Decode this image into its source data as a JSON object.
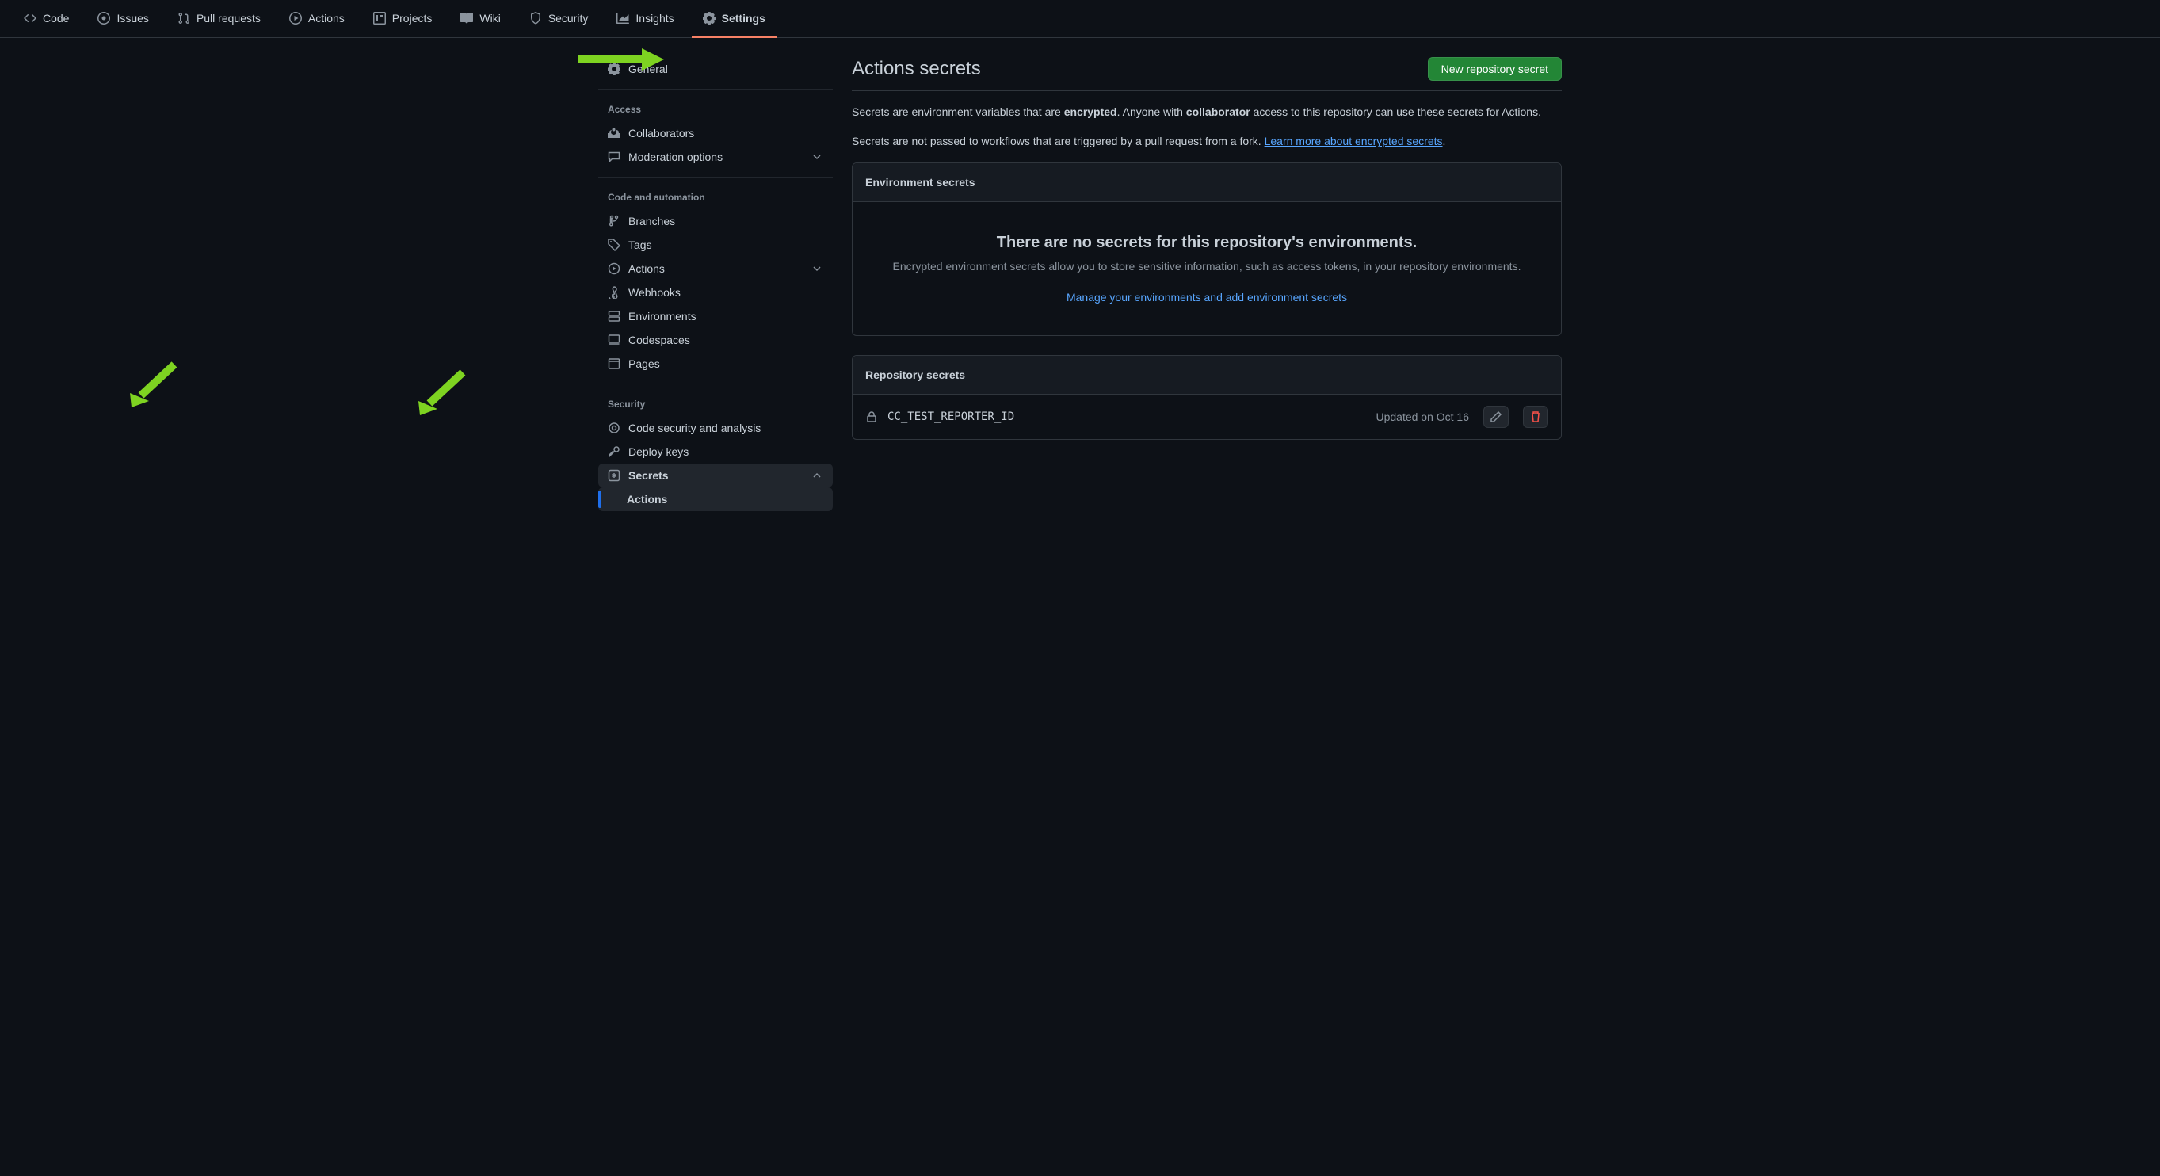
{
  "nav": {
    "code": "Code",
    "issues": "Issues",
    "pull": "Pull requests",
    "actions": "Actions",
    "projects": "Projects",
    "wiki": "Wiki",
    "security": "Security",
    "insights": "Insights",
    "settings": "Settings"
  },
  "sidebar": {
    "general": "General",
    "access_heading": "Access",
    "collaborators": "Collaborators",
    "moderation": "Moderation options",
    "code_auto_heading": "Code and automation",
    "branches": "Branches",
    "tags": "Tags",
    "actions": "Actions",
    "webhooks": "Webhooks",
    "environments": "Environments",
    "codespaces": "Codespaces",
    "pages": "Pages",
    "security_heading": "Security",
    "code_security": "Code security and analysis",
    "deploy_keys": "Deploy keys",
    "secrets": "Secrets",
    "secrets_actions": "Actions"
  },
  "main": {
    "title": "Actions secrets",
    "new_secret_btn": "New repository secret",
    "desc1_a": "Secrets are environment variables that are ",
    "desc1_b": "encrypted",
    "desc1_c": ". Anyone with ",
    "desc1_d": "collaborator",
    "desc1_e": " access to this repository can use these secrets for Actions.",
    "desc2_a": "Secrets are not passed to workflows that are triggered by a pull request from a fork. ",
    "desc2_link": "Learn more about encrypted secrets",
    "desc2_b": ".",
    "env_secrets_header": "Environment secrets",
    "env_empty_title": "There are no secrets for this repository's environments.",
    "env_empty_text": "Encrypted environment secrets allow you to store sensitive information, such as access tokens, in your repository environments.",
    "env_manage_link": "Manage your environments and add environment secrets",
    "repo_secrets_header": "Repository secrets",
    "secret": {
      "name": "CC_TEST_REPORTER_ID",
      "updated": "Updated on Oct 16"
    }
  }
}
